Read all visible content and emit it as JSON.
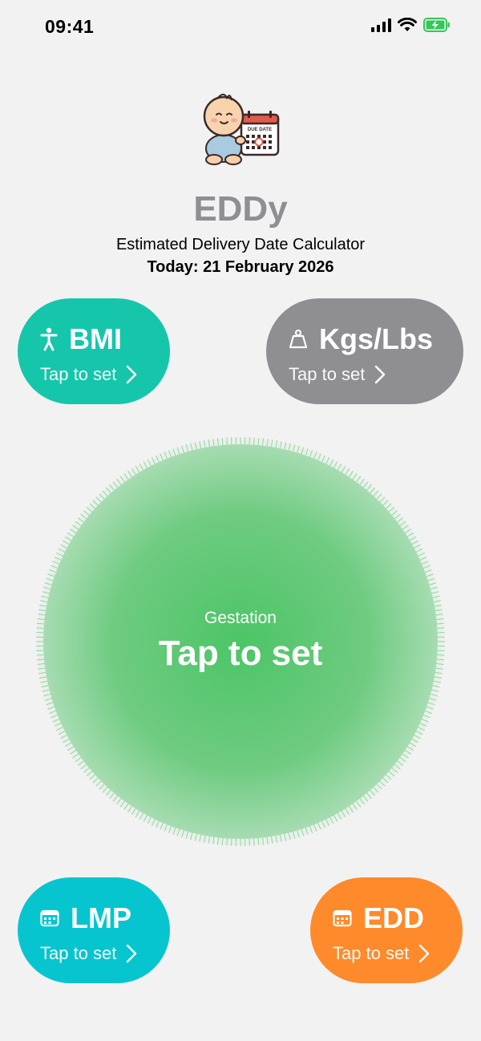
{
  "status_bar": {
    "time": "09:41"
  },
  "app": {
    "title": "EDDy",
    "subtitle": "Estimated Delivery Date Calculator",
    "today": "Today: 21 February 2026",
    "logo_badge_text": "DUE DATE"
  },
  "cards": {
    "bmi": {
      "label": "BMI",
      "hint": "Tap to set",
      "icon": "person-icon",
      "color": "#15c6ab"
    },
    "units": {
      "label": "Kgs/Lbs",
      "hint": "Tap to set",
      "icon": "scale-weight-icon",
      "color": "#8e8e93"
    },
    "lmp": {
      "label": "LMP",
      "hint": "Tap to set",
      "icon": "calendar-icon",
      "color": "#06c5cf"
    },
    "edd": {
      "label": "EDD",
      "hint": "Tap to set",
      "icon": "calendar-icon",
      "color": "#fe8a2b"
    }
  },
  "gestation": {
    "label": "Gestation",
    "value": "Tap to set",
    "color": "#4cc566"
  }
}
